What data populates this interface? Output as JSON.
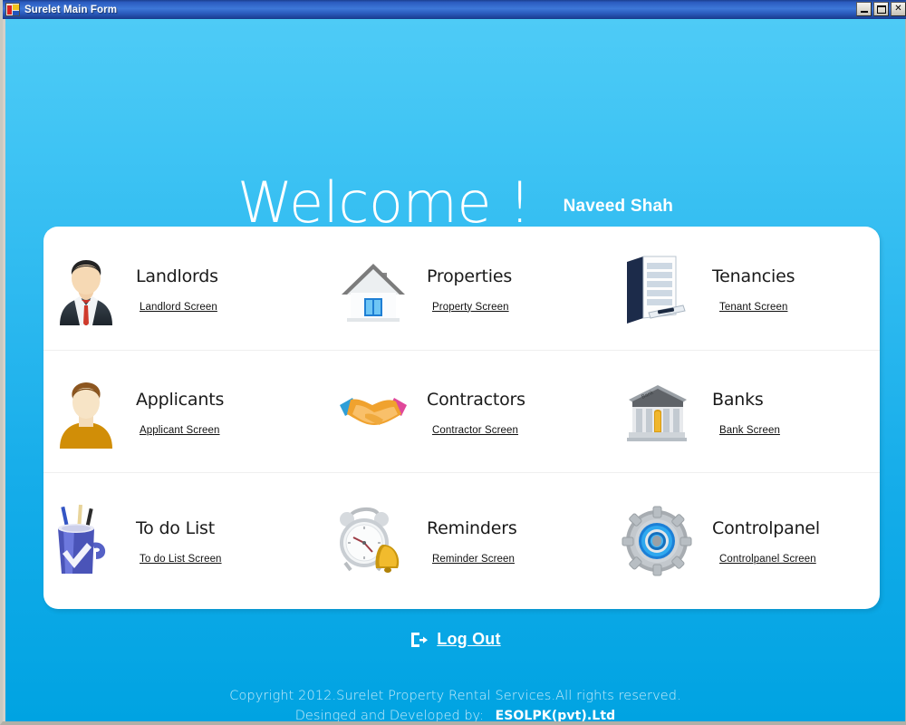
{
  "window": {
    "title": "Surelet Main Form",
    "icon": "form-icon",
    "buttons": {
      "minimize": "minimize-button",
      "maximize": "maximize-button",
      "close_label": "✕"
    }
  },
  "header": {
    "welcome": "Welcome !",
    "user_name": "Naveed Shah"
  },
  "menu": {
    "rows": [
      [
        {
          "title": "Landlords",
          "link": "Landlord Screen",
          "icon": "businessman-avatar-icon"
        },
        {
          "title": "Properties",
          "link": "Property Screen",
          "icon": "house-icon"
        },
        {
          "title": "Tenancies",
          "link": "Tenant Screen",
          "icon": "documents-binder-icon"
        }
      ],
      [
        {
          "title": "Applicants",
          "link": "Applicant Screen",
          "icon": "person-avatar-icon"
        },
        {
          "title": "Contractors",
          "link": "Contractor Screen",
          "icon": "handshake-icon"
        },
        {
          "title": "Banks",
          "link": "Bank Screen",
          "icon": "bank-building-icon"
        }
      ],
      [
        {
          "title": "To do List",
          "link": "To do List Screen",
          "icon": "pen-mug-checkmark-icon"
        },
        {
          "title": "Reminders",
          "link": "Reminder Screen",
          "icon": "alarm-clock-bell-icon"
        },
        {
          "title": "Controlpanel",
          "link": "Controlpanel Screen",
          "icon": "gear-icon"
        }
      ]
    ]
  },
  "footer": {
    "logout_label": "Log Out",
    "logout_icon": "logout-door-icon",
    "copyright": "Copyright 2012.Surelet Property Rental Services.All rights reserved.",
    "developed_by_label": "Desinged and Developed by:",
    "developer": "ESOLPK(pvt).Ltd"
  },
  "colors": {
    "background_top": "#4ecbf6",
    "background_bottom": "#00a3e2",
    "card": "#ffffff",
    "titlebar": "#2b5cc0",
    "footer_text": "#c9edfb"
  }
}
